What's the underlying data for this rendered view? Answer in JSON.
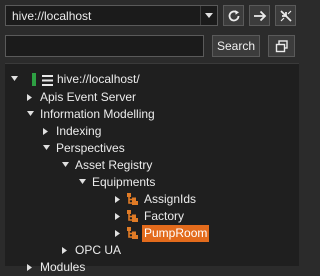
{
  "address": {
    "value": "hive://localhost"
  },
  "search": {
    "value": "",
    "button_label": "Search"
  },
  "tree": {
    "root": "hive://localhost/",
    "items": [
      {
        "label": "Apis Event Server"
      },
      {
        "label": "Information Modelling"
      },
      {
        "label": "Indexing"
      },
      {
        "label": "Perspectives"
      },
      {
        "label": "Asset Registry"
      },
      {
        "label": "Equipments"
      },
      {
        "label": "AssignIds"
      },
      {
        "label": "Factory"
      },
      {
        "label": "PumpRoom"
      },
      {
        "label": "OPC UA"
      },
      {
        "label": "Modules"
      }
    ],
    "selected": "PumpRoom"
  },
  "colors": {
    "background": "#2b2b2b",
    "tree_background": "#1f1f1f",
    "selection": "#e36b1c",
    "equipment_icon": "#e07b26",
    "status_indicator": "#2ea043"
  },
  "icons": {
    "dropdown": "chevron-down-icon",
    "refresh": "refresh-icon",
    "navigate": "arrow-right-icon",
    "collapse": "collapse-icon",
    "copy": "copy-icon",
    "server": "server-icon",
    "equipment": "equipment-icon"
  }
}
